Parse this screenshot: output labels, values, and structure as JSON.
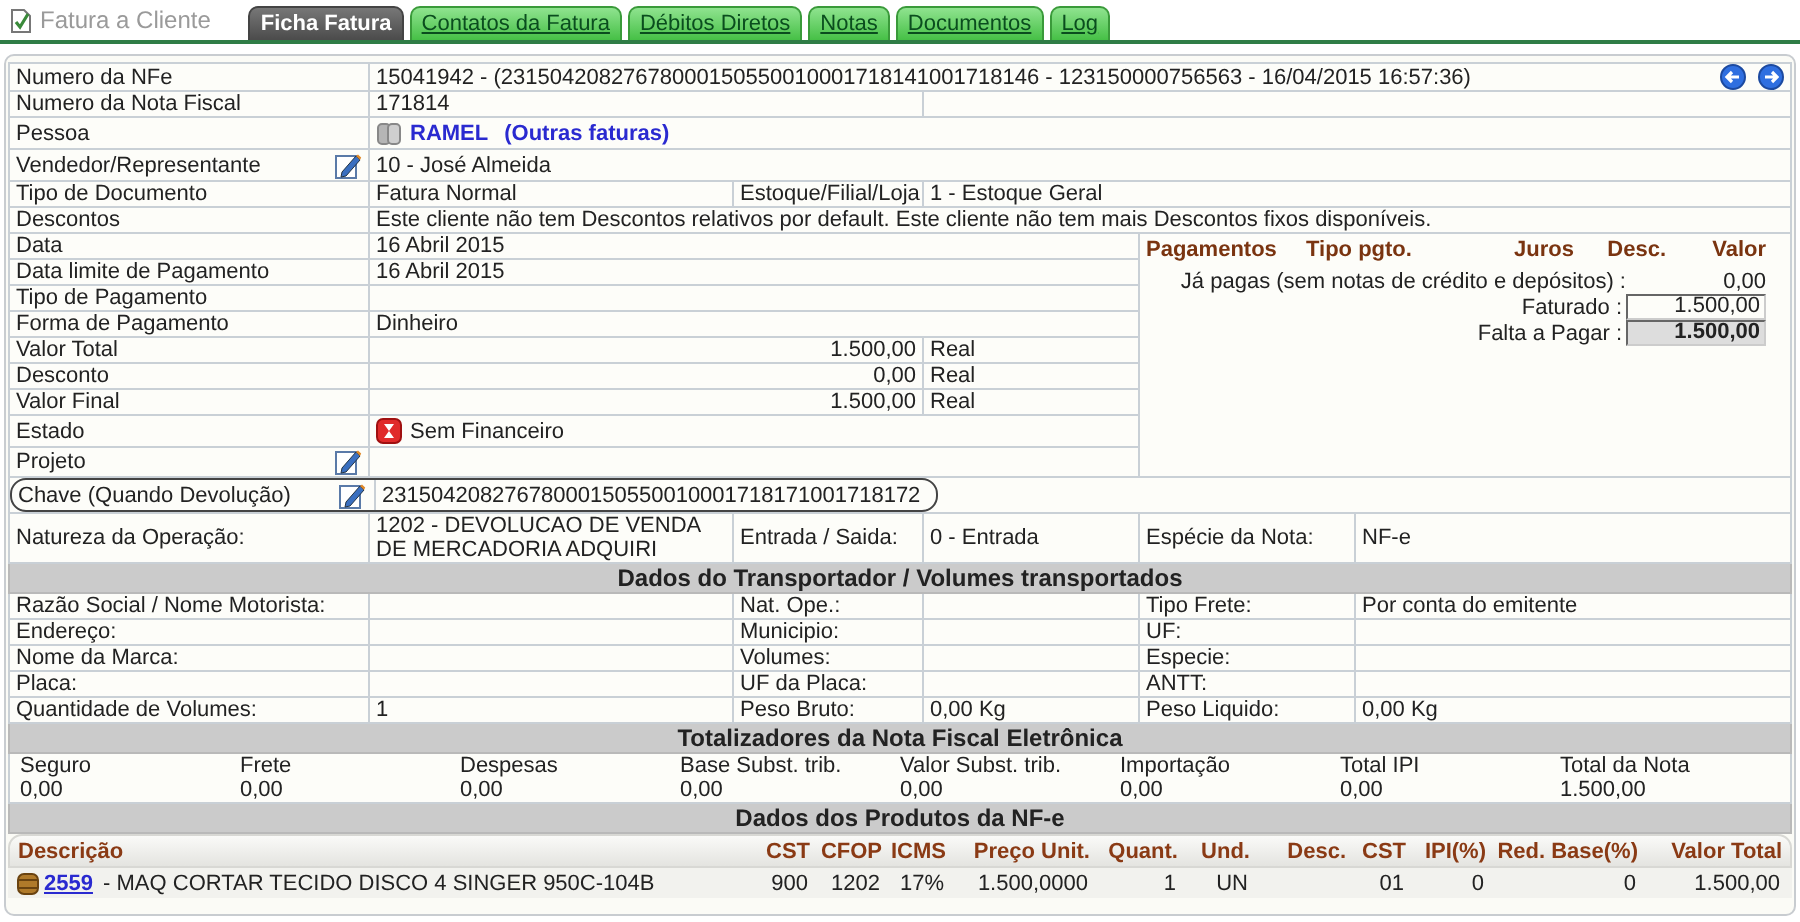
{
  "title": "Fatura a Cliente",
  "tabs": [
    {
      "label": "Ficha Fatura",
      "selected": true
    },
    {
      "label": "Contatos da Fatura",
      "selected": false
    },
    {
      "label": "Débitos Diretos",
      "selected": false
    },
    {
      "label": "Notas",
      "selected": false
    },
    {
      "label": "Documentos",
      "selected": false
    },
    {
      "label": "Log",
      "selected": false
    }
  ],
  "nfe": {
    "label": "Numero da NFe",
    "value": "15041942 - (23150420827678000150550010001718141001718146 - 123150000756563 - 16/04/2015 16:57:36)"
  },
  "nota_fiscal": {
    "label": "Numero da Nota Fiscal",
    "value": "171814"
  },
  "pessoa": {
    "label": "Pessoa",
    "name": "RAMEL",
    "link": "(Outras faturas)"
  },
  "vendedor": {
    "label": "Vendedor/Representante",
    "value": "10 - José Almeida"
  },
  "tipo_documento": {
    "label": "Tipo de Documento",
    "value": "Fatura Normal",
    "stock_label": "Estoque/Filial/Loja",
    "stock_value": "1 - Estoque Geral"
  },
  "descontos": {
    "label": "Descontos",
    "value": "Este cliente não tem Descontos relativos por default. Este cliente não tem mais Descontos fixos disponíveis."
  },
  "left_rows": [
    {
      "kind": "text",
      "label": "Data",
      "value": "16 Abril 2015"
    },
    {
      "kind": "text",
      "label": "Data limite de Pagamento",
      "value": "16 Abril 2015"
    },
    {
      "kind": "text",
      "label": "Tipo de Pagamento"
    },
    {
      "kind": "text",
      "label": "Forma de Pagamento",
      "value": "Dinheiro"
    },
    {
      "kind": "amount",
      "label": "Valor Total",
      "value": "1.500,00",
      "currency": "Real"
    },
    {
      "kind": "amount",
      "label": "Desconto",
      "value": "0,00",
      "currency": "Real"
    },
    {
      "kind": "amount",
      "label": "Valor Final",
      "value": "1.500,00",
      "currency": "Real"
    }
  ],
  "estado": {
    "label": "Estado",
    "value": "Sem Financeiro"
  },
  "projeto": {
    "label": "Projeto"
  },
  "chave": {
    "label": "Chave (Quando Devolução)",
    "value": "23150420827678000150550010001718171001718172",
    "highlighted": true
  },
  "operation_row": [
    {
      "label": "Natureza da Operação:",
      "value": "1202 - DEVOLUCAO DE VENDA DE MERCADORIA ADQUIRI"
    },
    {
      "label": "Entrada / Saida:",
      "value": "0 - Entrada"
    },
    {
      "label": "Espécie da Nota:",
      "value": "NF-e"
    }
  ],
  "payments": {
    "columns": [
      "Pagamentos",
      "Tipo pgto.",
      "Juros",
      "Desc.",
      "Valor"
    ],
    "already_paid": {
      "label": "Já pagas (sem notas de crédito e depósitos) :",
      "value": "0,00"
    },
    "invoiced": {
      "label": "Faturado :",
      "value": "1.500,00"
    },
    "outstanding": {
      "label": "Falta a Pagar :",
      "value": "1.500,00"
    }
  },
  "transport": {
    "title": "Dados do Transportador / Volumes transportados",
    "rows": [
      {
        "cells": [
          {
            "label": "Razão Social / Nome Motorista:"
          },
          {
            "label": "Nat. Ope.:"
          },
          {
            "label": "Tipo Frete:",
            "value": "Por conta do emitente"
          }
        ]
      },
      {
        "cells": [
          {
            "label": "Endereço:"
          },
          {
            "label": "Municipio:"
          },
          {
            "label": "UF:"
          }
        ]
      },
      {
        "cells": [
          {
            "label": "Nome da Marca:"
          },
          {
            "label": "Volumes:"
          },
          {
            "label": "Especie:"
          }
        ]
      },
      {
        "cells": [
          {
            "label": "Placa:"
          },
          {
            "label": "UF da Placa:"
          },
          {
            "label": "ANTT:"
          }
        ]
      },
      {
        "cells": [
          {
            "label": "Quantidade de Volumes:",
            "value": "1"
          },
          {
            "label": "Peso Bruto:",
            "value": "0,00 Kg"
          },
          {
            "label": "Peso Liquido:",
            "value": "0,00 Kg"
          }
        ]
      }
    ]
  },
  "totals": {
    "title": "Totalizadores da Nota Fiscal Eletrônica",
    "items": [
      {
        "label": "Seguro",
        "value": "0,00"
      },
      {
        "label": "Frete",
        "value": "0,00"
      },
      {
        "label": "Despesas",
        "value": "0,00"
      },
      {
        "label": "Base Subst. trib.",
        "value": "0,00"
      },
      {
        "label": "Valor Subst. trib.",
        "value": "0,00"
      },
      {
        "label": "Importação",
        "value": "0,00"
      },
      {
        "label": "Total IPI",
        "value": "0,00"
      },
      {
        "label": "Total da Nota",
        "value": "1.500,00"
      }
    ]
  },
  "products": {
    "title": "Dados dos Produtos da NF-e",
    "columns": [
      "Descrição",
      "CST",
      "CFOP",
      "ICMS",
      "Preço Unit.",
      "Quant.",
      "Und.",
      "Desc.",
      "CST",
      "IPI(%)",
      "Red. Base(%)",
      "Valor Total"
    ],
    "rows": [
      {
        "cells": [
          {
            "code": "2559",
            "text": " - MAQ CORTAR TECIDO DISCO 4 SINGER 950C-104B"
          },
          {
            "text": "900"
          },
          {
            "text": "1202"
          },
          {
            "text": "17%"
          },
          {
            "text": "1.500,0000"
          },
          {
            "text": "1"
          },
          {
            "text": "UN"
          },
          {
            "text": ""
          },
          {
            "text": "01"
          },
          {
            "text": "0"
          },
          {
            "text": "0"
          },
          {
            "text": "1.500,00"
          }
        ]
      }
    ]
  }
}
